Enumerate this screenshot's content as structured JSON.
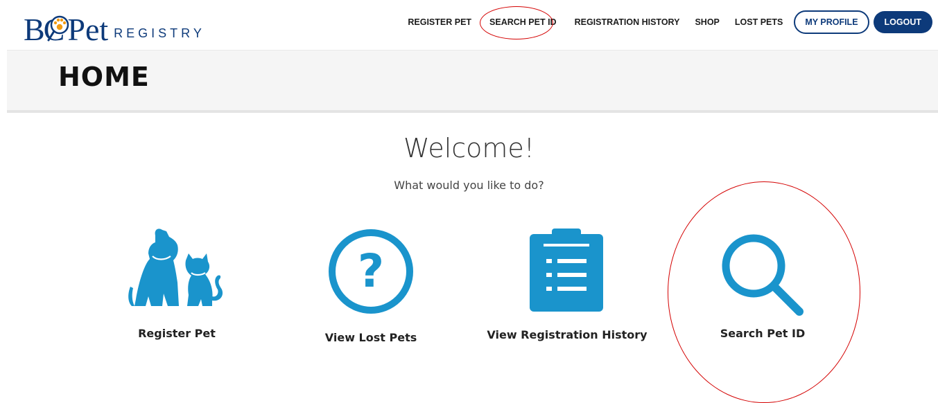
{
  "brand": {
    "bc": "BC",
    "pet": "Pet",
    "registry": "REGISTRY",
    "color": "#0d3a7a",
    "paw_color": "#f39c12"
  },
  "nav": {
    "items": [
      {
        "label": "REGISTER PET"
      },
      {
        "label": "SEARCH PET ID"
      },
      {
        "label": "REGISTRATION HISTORY"
      },
      {
        "label": "SHOP"
      },
      {
        "label": "LOST PETS"
      }
    ],
    "profile": "MY PROFILE",
    "logout": "LOGOUT"
  },
  "page": {
    "title": "HOME"
  },
  "main": {
    "welcome": "Welcome!",
    "subtitle": "What would you like to do?",
    "icon_color": "#1a94cc",
    "tiles": [
      {
        "label": "Register Pet",
        "icon": "dog-and-cat-icon"
      },
      {
        "label": "View Lost Pets",
        "icon": "question-circle-icon"
      },
      {
        "label": "View Registration History",
        "icon": "clipboard-list-icon"
      },
      {
        "label": "Search Pet ID",
        "icon": "magnifier-icon"
      }
    ]
  },
  "annotation_color": "#d40000"
}
